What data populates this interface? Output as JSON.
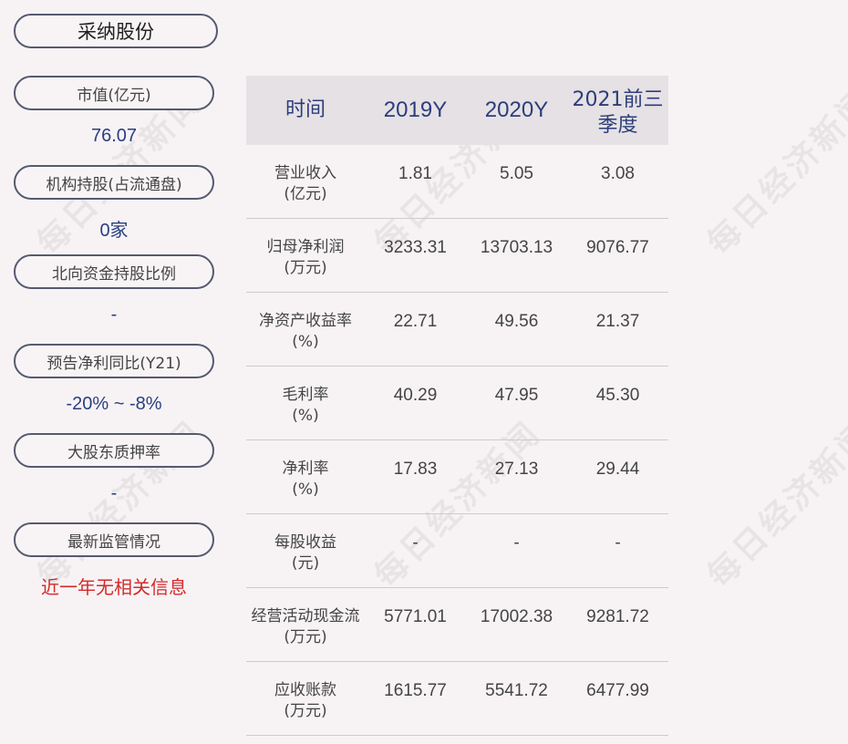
{
  "company_name": "采纳股份",
  "metrics": [
    {
      "label": "市值(亿元)",
      "value": "76.07"
    },
    {
      "label": "机构持股(占流通盘)",
      "value": "0家"
    },
    {
      "label": "北向资金持股比例",
      "value": "-"
    },
    {
      "label": "预告净利同比(Y21)",
      "value": "-20% ~ -8%"
    },
    {
      "label": "大股东质押率",
      "value": "-"
    },
    {
      "label": "最新监管情况",
      "value": "近一年无相关信息"
    }
  ],
  "table": {
    "headers": [
      "时间",
      "2019Y",
      "2020Y",
      "2021前三季度"
    ],
    "rows": [
      {
        "label": "营业收入",
        "unit": "(亿元)",
        "values": [
          "1.81",
          "5.05",
          "3.08"
        ]
      },
      {
        "label": "归母净利润",
        "unit": "(万元)",
        "values": [
          "3233.31",
          "13703.13",
          "9076.77"
        ]
      },
      {
        "label": "净资产收益率",
        "unit": "(%)",
        "values": [
          "22.71",
          "49.56",
          "21.37"
        ]
      },
      {
        "label": "毛利率",
        "unit": "(%)",
        "values": [
          "40.29",
          "47.95",
          "45.30"
        ]
      },
      {
        "label": "净利率",
        "unit": "(%)",
        "values": [
          "17.83",
          "27.13",
          "29.44"
        ]
      },
      {
        "label": "每股收益",
        "unit": "(元)",
        "values": [
          "-",
          "-",
          "-"
        ]
      },
      {
        "label": "经营活动现金流",
        "unit": "(万元)",
        "values": [
          "5771.01",
          "17002.38",
          "9281.72"
        ]
      },
      {
        "label": "应收账款",
        "unit": "(万元)",
        "values": [
          "1615.77",
          "5541.72",
          "6477.99"
        ]
      }
    ]
  },
  "watermark_text": "每日经济新闻",
  "colors": {
    "value_blue": "#2a3f7e",
    "alert_red": "#d52a2a",
    "header_bg": "#e5e1e4"
  }
}
